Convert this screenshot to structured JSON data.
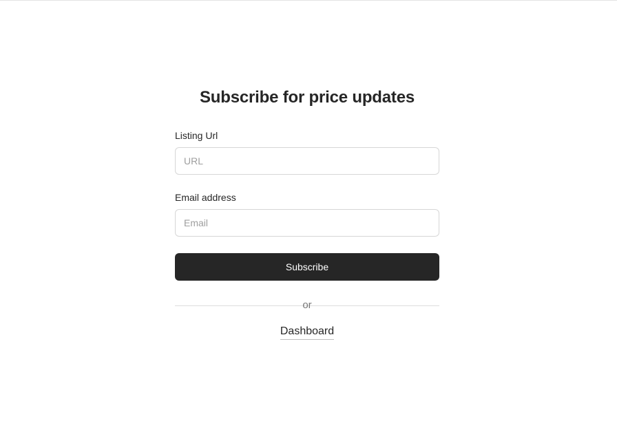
{
  "form": {
    "title": "Subscribe for price updates",
    "listing_url": {
      "label": "Listing Url",
      "placeholder": "URL",
      "value": ""
    },
    "email": {
      "label": "Email address",
      "placeholder": "Email",
      "value": ""
    },
    "submit_label": "Subscribe",
    "divider_text": "or",
    "dashboard_link": "Dashboard"
  },
  "colors": {
    "button_bg": "#262626",
    "button_text": "#ffffff",
    "border": "#d6d6d6",
    "placeholder": "#9e9e9e"
  }
}
